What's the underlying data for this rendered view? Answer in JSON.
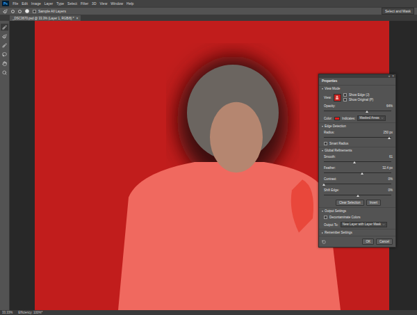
{
  "app": {
    "logo": "Ps",
    "menu": [
      "File",
      "Edit",
      "Image",
      "Layer",
      "Type",
      "Select",
      "Filter",
      "3D",
      "View",
      "Window",
      "Help"
    ]
  },
  "options_bar": {
    "sample_all_layers": {
      "label": "Sample All Layers",
      "checked": false
    },
    "workspace": "Select and Mask"
  },
  "document_tab": {
    "title": "_DSC3670.psd @ 33.3% (Layer 1, RGB/8) *",
    "close": "×",
    "selected": true
  },
  "tools": [
    {
      "selected": true
    },
    {
      "selected": false
    },
    {
      "selected": false
    },
    {
      "selected": false
    },
    {
      "selected": false
    },
    {
      "selected": false
    }
  ],
  "properties": {
    "title": "Properties",
    "collapse": "«",
    "close": "×",
    "sections": [
      {
        "title": "View Mode",
        "expanded": true,
        "rows": [
          {
            "kind": "view",
            "label": "View:",
            "checks": [
              {
                "label": "Show Edge (J)",
                "checked": false
              },
              {
                "label": "Show Original (P)",
                "checked": false
              }
            ]
          },
          {
            "kind": "slider",
            "label": "Opacity:",
            "reading": "64%",
            "level": 0.64
          },
          {
            "kind": "color",
            "label": "Color:",
            "swatch": "#e21b1b",
            "indicates_label": "Indicates:",
            "indicates_value": "Masked Areas"
          }
        ]
      },
      {
        "title": "Edge Detection",
        "expanded": true,
        "rows": [
          {
            "kind": "slider",
            "label": "Radius:",
            "reading": "250 px",
            "level": 0.97
          },
          {
            "kind": "checkbox",
            "label": "Smart Radius",
            "checked": false
          }
        ]
      },
      {
        "title": "Global Refinements",
        "expanded": true,
        "rows": [
          {
            "kind": "slider",
            "label": "Smooth:",
            "reading": "61",
            "level": 0.45
          },
          {
            "kind": "slider",
            "label": "Feather:",
            "reading": "32.4 px",
            "level": 0.57
          },
          {
            "kind": "slider",
            "label": "Contrast:",
            "reading": "0%",
            "level": 0
          },
          {
            "kind": "slider",
            "label": "Shift Edge:",
            "reading": "0%",
            "level": 0.5
          },
          {
            "kind": "buttons",
            "buttons": [
              "Clear Selection",
              "Invert"
            ]
          }
        ]
      },
      {
        "title": "Output Settings",
        "expanded": true,
        "rows": [
          {
            "kind": "checkbox",
            "label": "Decontaminate Colors",
            "checked": false
          },
          {
            "kind": "select",
            "label": "Output To:",
            "value": "New Layer with Layer Mask"
          }
        ]
      },
      {
        "title": "Remember Settings",
        "expanded": false,
        "rows": []
      }
    ],
    "buttons": [
      "OK",
      "Cancel"
    ]
  },
  "status_bar": {
    "zoom": "33.33%",
    "info": "Efficiency: 100%*"
  }
}
